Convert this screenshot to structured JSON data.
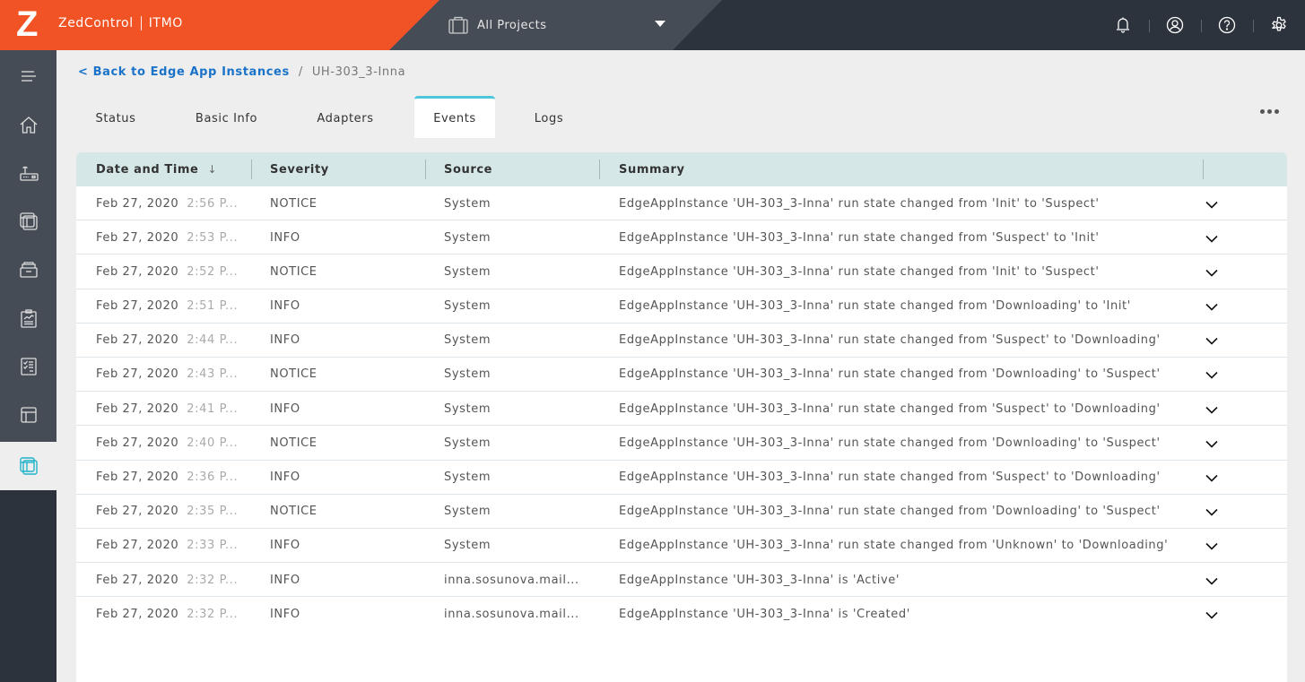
{
  "header": {
    "logo_letter": "Z",
    "app_name": "ZedControl",
    "org": "ITMO",
    "project_selector": "All Projects",
    "icons": [
      "bell-icon",
      "user-icon",
      "help-icon",
      "settings-icon"
    ]
  },
  "sidebar": {
    "items": [
      {
        "icon": "menu-icon"
      },
      {
        "icon": "home-icon"
      },
      {
        "icon": "edge-node-icon"
      },
      {
        "icon": "edge-app-icon"
      },
      {
        "icon": "storage-icon"
      },
      {
        "icon": "clipboard-chart-icon"
      },
      {
        "icon": "checklist-icon"
      },
      {
        "icon": "layout-icon"
      },
      {
        "icon": "edge-app-instances-icon",
        "active": true
      }
    ],
    "accent_color": "#1fb3c8"
  },
  "breadcrumb": {
    "back_label": "< Back to Edge App Instances",
    "separator": "/",
    "current": "UH-303_3-Inna"
  },
  "tabs": [
    {
      "label": "Status",
      "active": false
    },
    {
      "label": "Basic Info",
      "active": false
    },
    {
      "label": "Adapters",
      "active": false
    },
    {
      "label": "Events",
      "active": true
    },
    {
      "label": "Logs",
      "active": false
    }
  ],
  "more_menu_icon": "more-horizontal-icon",
  "table": {
    "columns": [
      "Date and Time",
      "Severity",
      "Source",
      "Summary"
    ],
    "sort_indicator": "↓",
    "rows": [
      {
        "date": "Feb 27, 2020",
        "time": "2:56 P...",
        "severity": "NOTICE",
        "source": "System",
        "summary": "EdgeAppInstance 'UH-303_3-Inna' run state changed from 'Init' to 'Suspect'"
      },
      {
        "date": "Feb 27, 2020",
        "time": "2:53 P...",
        "severity": "INFO",
        "source": "System",
        "summary": "EdgeAppInstance 'UH-303_3-Inna' run state changed from 'Suspect' to 'Init'"
      },
      {
        "date": "Feb 27, 2020",
        "time": "2:52 P...",
        "severity": "NOTICE",
        "source": "System",
        "summary": "EdgeAppInstance 'UH-303_3-Inna' run state changed from 'Init' to 'Suspect'"
      },
      {
        "date": "Feb 27, 2020",
        "time": "2:51 P...",
        "severity": "INFO",
        "source": "System",
        "summary": "EdgeAppInstance 'UH-303_3-Inna' run state changed from 'Downloading' to 'Init'"
      },
      {
        "date": "Feb 27, 2020",
        "time": "2:44 P...",
        "severity": "INFO",
        "source": "System",
        "summary": "EdgeAppInstance 'UH-303_3-Inna' run state changed from 'Suspect' to 'Downloading'"
      },
      {
        "date": "Feb 27, 2020",
        "time": "2:43 P...",
        "severity": "NOTICE",
        "source": "System",
        "summary": "EdgeAppInstance 'UH-303_3-Inna' run state changed from 'Downloading' to 'Suspect'"
      },
      {
        "date": "Feb 27, 2020",
        "time": "2:41 P...",
        "severity": "INFO",
        "source": "System",
        "summary": "EdgeAppInstance 'UH-303_3-Inna' run state changed from 'Suspect' to 'Downloading'"
      },
      {
        "date": "Feb 27, 2020",
        "time": "2:40 P...",
        "severity": "NOTICE",
        "source": "System",
        "summary": "EdgeAppInstance 'UH-303_3-Inna' run state changed from 'Downloading' to 'Suspect'"
      },
      {
        "date": "Feb 27, 2020",
        "time": "2:36 P...",
        "severity": "INFO",
        "source": "System",
        "summary": "EdgeAppInstance 'UH-303_3-Inna' run state changed from 'Suspect' to 'Downloading'"
      },
      {
        "date": "Feb 27, 2020",
        "time": "2:35 P...",
        "severity": "NOTICE",
        "source": "System",
        "summary": "EdgeAppInstance 'UH-303_3-Inna' run state changed from 'Downloading' to 'Suspect'"
      },
      {
        "date": "Feb 27, 2020",
        "time": "2:33 P...",
        "severity": "INFO",
        "source": "System",
        "summary": "EdgeAppInstance 'UH-303_3-Inna' run state changed from 'Unknown' to 'Downloading'"
      },
      {
        "date": "Feb 27, 2020",
        "time": "2:32 P...",
        "severity": "INFO",
        "source": "inna.sosunova.mail...",
        "summary": "EdgeAppInstance 'UH-303_3-Inna' is 'Active'"
      },
      {
        "date": "Feb 27, 2020",
        "time": "2:32 P...",
        "severity": "INFO",
        "source": "inna.sosunova.mail...",
        "summary": "EdgeAppInstance 'UH-303_3-Inna' is 'Created'"
      }
    ]
  },
  "colors": {
    "brand_orange": "#f15325",
    "header_dark": "#2d333c",
    "header_mid": "#454c55",
    "link_blue": "#1a73c8",
    "tab_accent": "#4dc6db",
    "table_header_bg": "#d6e7e7"
  }
}
